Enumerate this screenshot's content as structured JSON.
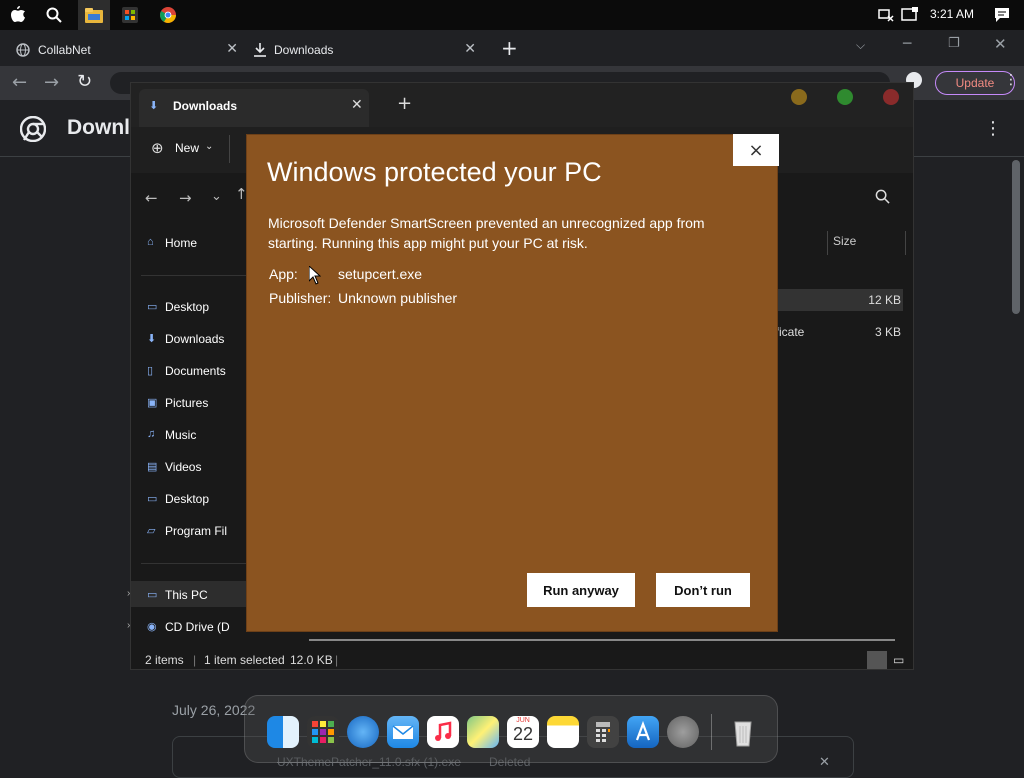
{
  "topbar": {
    "time": "3:21 AM"
  },
  "browser": {
    "tabs": [
      {
        "label": "CollabNet"
      },
      {
        "label": "Downloads"
      }
    ],
    "new_tab": "+",
    "update_label": "Update",
    "page_heading": "Downl",
    "bg_date": "July 26, 2022",
    "bg_file": "UXThemePatcher_11.0.sfx (1).exe",
    "bg_file_status": "Deleted"
  },
  "explorer": {
    "tab_label": "Downloads",
    "new_label": "New",
    "nav": [
      "Home",
      "Desktop",
      "Downloads",
      "Documents",
      "Pictures",
      "Music",
      "Videos",
      "Desktop",
      "Program Fil",
      "This PC",
      "CD Drive (D"
    ],
    "column_size": "Size",
    "rows": [
      {
        "name": "",
        "size": "12 KB"
      },
      {
        "name": "ificate",
        "size": "3 KB"
      }
    ],
    "status": {
      "items": "2 items",
      "selected": "1 item selected",
      "size": "12.0 KB"
    }
  },
  "dialog": {
    "title": "Windows protected your PC",
    "body": "Microsoft Defender SmartScreen prevented an unrecognized app from starting. Running this app might put your PC at risk.",
    "app_label": "App:",
    "app_value": "setupcert.exe",
    "publisher_label": "Publisher:",
    "publisher_value": "Unknown publisher",
    "run_anyway": "Run anyway",
    "dont_run": "Don’t run",
    "close": "×"
  },
  "dock": {
    "calendar_month": "JUN",
    "calendar_day": "22"
  },
  "colors": {
    "dialog_bg": "#8b5420",
    "accent": "#8ab4f8"
  }
}
